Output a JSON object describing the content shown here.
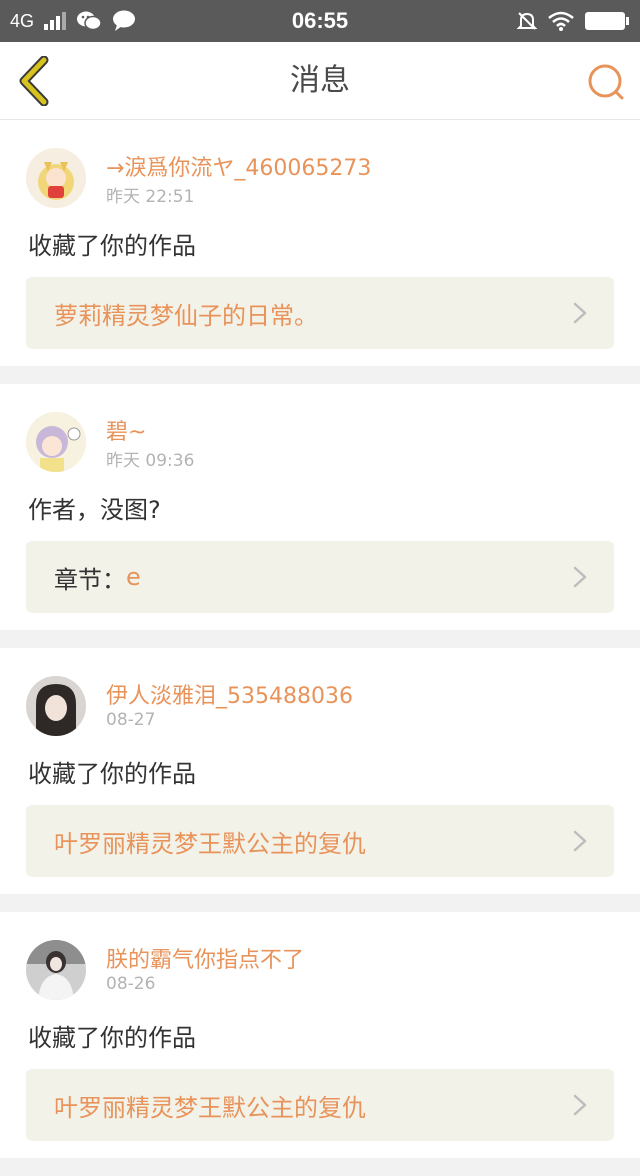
{
  "status_bar": {
    "network": "4G",
    "time": "06:55"
  },
  "header": {
    "title": "消息",
    "back_icon": "chevron-left-icon",
    "search_icon": "search-icon"
  },
  "colors": {
    "accent": "#e8935a",
    "back_arrow": "#d7c31d",
    "card_background": "#f3f2e9"
  },
  "messages": [
    {
      "user": "→淚爲你流ヤ_460065273",
      "time": "昨天 22:51",
      "action": "收藏了你的作品",
      "work_prefix": "",
      "work": "萝莉精灵梦仙子的日常。"
    },
    {
      "user": "碧~",
      "time": "昨天 09:36",
      "action": "作者，没图?",
      "work_prefix": "章节：",
      "work": "e"
    },
    {
      "user": "伊人淡雅泪_535488036",
      "time": "08-27",
      "action": "收藏了你的作品",
      "work_prefix": "",
      "work": "叶罗丽精灵梦王默公主的复仇"
    },
    {
      "user": "朕的霸气你指点不了",
      "time": "08-26",
      "action": "收藏了你的作品",
      "work_prefix": "",
      "work": "叶罗丽精灵梦王默公主的复仇"
    }
  ]
}
